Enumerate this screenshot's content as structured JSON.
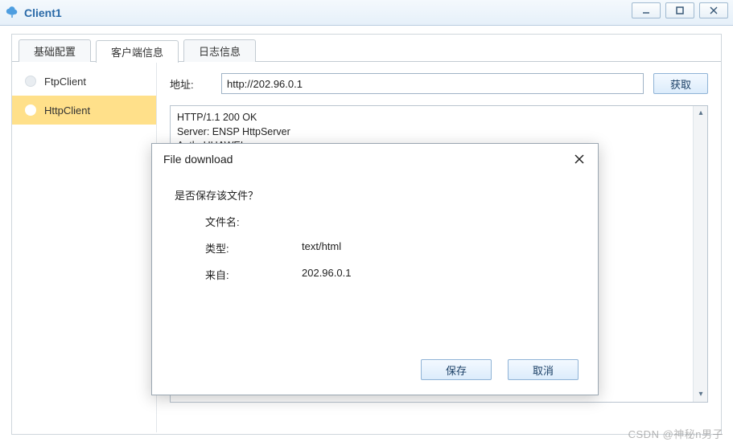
{
  "window": {
    "title": "Client1"
  },
  "tabs": {
    "basic": "基础配置",
    "clientinfo": "客户端信息",
    "log": "日志信息"
  },
  "sidebar": {
    "items": [
      {
        "label": "FtpClient"
      },
      {
        "label": "HttpClient"
      }
    ]
  },
  "main": {
    "address_label": "地址:",
    "address_value": "http://202.96.0.1",
    "fetch_label": "获取",
    "response_lines": [
      "HTTP/1.1 200 OK",
      "Server: ENSP HttpServer",
      "Auth: HUAWEI"
    ]
  },
  "dialog": {
    "title": "File download",
    "question": "是否保存该文件？",
    "filename_label": "文件名:",
    "filename_value": "",
    "type_label": "类型:",
    "type_value": "text/html",
    "from_label": "来自:",
    "from_value": "202.96.0.1",
    "save_label": "保存",
    "cancel_label": "取消"
  },
  "watermark": "CSDN @神秘n男子"
}
